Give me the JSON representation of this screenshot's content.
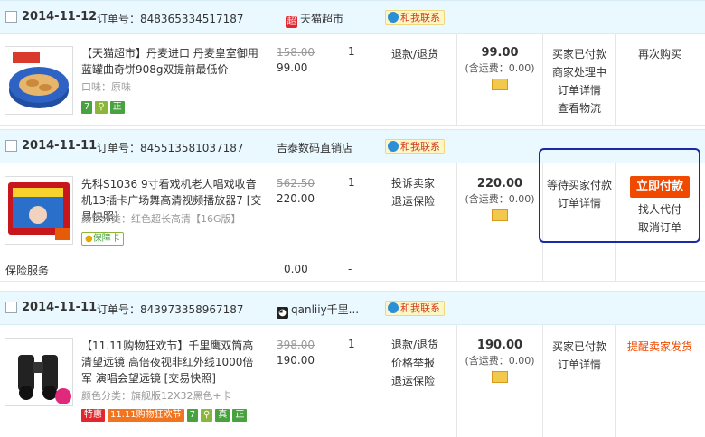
{
  "orders": [
    {
      "date": "2014-11-12",
      "order_label": "订单号：",
      "order_no": "848365334517187",
      "shop_icon": "超",
      "shop": "天猫超市",
      "chat_label": "和我联系",
      "item": {
        "title": "【天猫超市】丹麦进口 丹麦皇室御用蓝罐曲奇饼908g双提前最低价",
        "sku": "口味：原味",
        "badges": [
          "7",
          "⚲",
          "正"
        ],
        "price_old": "158.00",
        "price": "99.00",
        "qty": "1",
        "service": [
          "退款/退货"
        ],
        "total": "99.00",
        "shipping": "(含运费：0.00)",
        "status": [
          "买家已付款",
          "商家处理中",
          "订单详情",
          "查看物流"
        ],
        "actions": [
          "再次购买"
        ]
      }
    },
    {
      "date": "2014-11-11",
      "order_label": "订单号：",
      "order_no": "845513581037187",
      "shop": "吉泰数码直销店",
      "chat_label": "和我联系",
      "item": {
        "title": "先科S1036 9寸看戏机老人唱戏收音机13插卡广场舞高清视频播放器7 [交易快照]",
        "sku": "颜色分类：红色超长高清【16G版】",
        "badge_text": "保障卡",
        "price_old": "562.50",
        "price": "220.00",
        "qty": "1",
        "service": [
          "投诉卖家",
          "退运保险"
        ],
        "total": "220.00",
        "shipping": "(含运费：0.00)",
        "status": [
          "等待买家付款",
          "订单详情"
        ],
        "pay_button": "立即付款",
        "actions": [
          "找人代付",
          "取消订单"
        ]
      },
      "insurance": {
        "label": "保险服务",
        "price": "0.00",
        "qty": "-"
      }
    },
    {
      "date": "2014-11-11",
      "order_label": "订单号：",
      "order_no": "843973358967187",
      "shop": "qanliiy千里...",
      "chat_label": "和我联系",
      "item": {
        "title": "【11.11购物狂欢节】千里鹰双筒高清望远镜 高倍夜视非红外线1000倍军 演唱会望远镜 [交易快照]",
        "sku": "颜色分类：旗舰版12X32黑色+卡",
        "badges_special": [
          "特惠",
          "11.11购物狂欢节"
        ],
        "badges": [
          "7",
          "⚲",
          "真",
          "正"
        ],
        "price_old": "398.00",
        "price": "190.00",
        "qty": "1",
        "service": [
          "退款/退货",
          "价格举报",
          "退运保险"
        ],
        "total": "190.00",
        "shipping": "(含运费：0.00)",
        "status": [
          "买家已付款",
          "订单详情"
        ],
        "actions": [
          "提醒卖家发货"
        ]
      }
    }
  ],
  "colors": {
    "header_bg": "#eaf8ff",
    "accent": "#f04a00",
    "highlight": "#1a2aa6"
  }
}
